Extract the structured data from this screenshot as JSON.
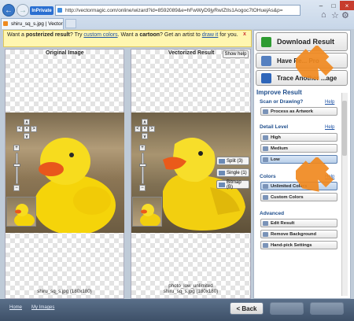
{
  "browser": {
    "inprivate_label": "InPrivate",
    "url": "http://vectormagic.com/online/wizard?id=8592089&e=hFwWyD9jyRwIZtIs1Aogoc7tOHuejAs&p=",
    "tab_title": "shiru_sq_s.jpg | Vector ...",
    "minimize": "–",
    "maximize": "□",
    "close": "×",
    "home_icon": "⌂",
    "star_icon": "☆",
    "settings_icon": "⚙"
  },
  "banner": {
    "text_1": "Want a ",
    "bold_1": "posterized result",
    "text_2": "? Try ",
    "link_1": "custom colors",
    "text_3": ". Want a ",
    "bold_2": "cartoon",
    "text_4": "? Get an artist to ",
    "link_2": "draw it",
    "text_5": " for you.",
    "close": "x"
  },
  "panels": {
    "original_label": "Original Image",
    "vectorized_label": "Vectorized Result",
    "show_help": "Show help",
    "zoom_up": "∧",
    "zoom_left": "<",
    "zoom_center": "•",
    "zoom_right": ">",
    "zoom_down": "∨",
    "zoom_in": "+",
    "zoom_out": "−",
    "original_filename": "shiru_sq_s.jpg (180x180)",
    "vectorized_filename_1": "photo_low_unlimited",
    "vectorized_filename_2": "shiru_sq_s.jpg (180x180)",
    "view_split": "Split (3)",
    "view_single": "Single (1)",
    "view_bitmap": "Bitmap (B)"
  },
  "sidebar": {
    "download": "Download Result",
    "more_options": "Have Re... Pro",
    "trace": "Trace Another ...age",
    "improve_title": "Improve Result",
    "help": "Help",
    "scan_title": "Scan or Drawing?",
    "process_artwork": "Process as Artwork",
    "detail_title": "Detail Level",
    "detail_options": [
      "High",
      "Medium",
      "Low"
    ],
    "colors_title": "Colors",
    "color_options": [
      "Unlimited Colors",
      "Custom Colors"
    ],
    "advanced_title": "Advanced",
    "advanced_options": [
      "Edit Result",
      "Remove Background",
      "Hand-pick Settings"
    ]
  },
  "footer": {
    "home": "Home",
    "my_images": "My Images",
    "back": "< Back"
  },
  "colors": {
    "accent_arrow": "#f0891f",
    "download_icon": "#2e9b32",
    "duck_yellow": "#f5d40a",
    "beak_orange": "#e8571c"
  }
}
